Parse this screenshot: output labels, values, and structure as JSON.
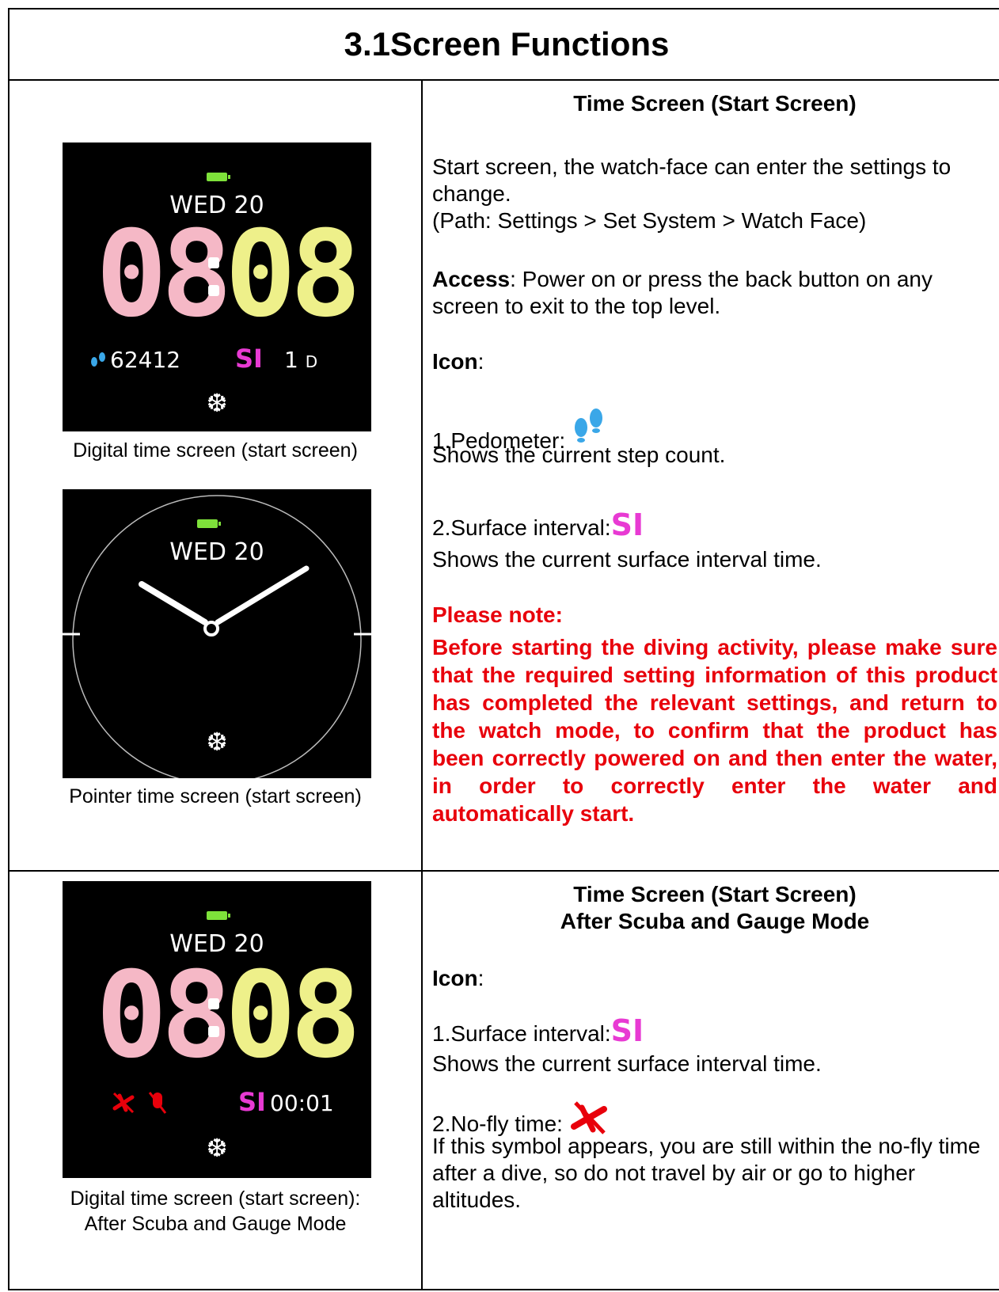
{
  "title": "3.1Screen Functions",
  "watch1": {
    "date": "WED 20",
    "hour": "08",
    "minute": "08",
    "steps": "62412",
    "si": "SI",
    "days": "1",
    "days_unit": "D"
  },
  "watch2": {
    "date": "WED 20"
  },
  "watch3": {
    "date": "WED 20",
    "hour": "08",
    "minute": "08",
    "si": "SI",
    "interval": "00:01"
  },
  "captions": {
    "c1": "Digital time screen (start screen)",
    "c2": "Pointer time screen (start screen)",
    "c3_line1": "Digital time screen (start screen):",
    "c3_line2": "After Scuba and Gauge Mode"
  },
  "section1": {
    "heading": "Time Screen (Start Screen)",
    "intro_line1": "Start screen, the watch-face can enter the settings to change.",
    "path": "(Path: Settings > Set System > Watch Face)",
    "access_label": "Access",
    "access_text": ": Power on or press the back button on any screen to exit to the top level.",
    "icon_label": "Icon",
    "icon_colon": ":",
    "item1_label": "1.Pedometer:",
    "item1_desc": "Shows the current step count.",
    "item2_label": "2.Surface interval:",
    "item2_icon": "SI",
    "item2_desc": "Shows the current surface interval time.",
    "note_title": "Please note:",
    "note_text": "Before starting the diving activity, please make sure that the required setting information of this product has completed the relevant settings, and return to the watch mode, to confirm that the product has been correctly powered on and then enter the water, in order to correctly enter the water and automatically start."
  },
  "section2": {
    "heading_line1": "Time Screen (Start Screen)",
    "heading_line2": "After Scuba and Gauge Mode",
    "icon_label": "Icon",
    "icon_colon": ":",
    "item1_label": "1.Surface interval:",
    "item1_icon": "SI",
    "item1_desc": "Shows the current surface interval time.",
    "item2_label": "2.No-fly time:",
    "item2_desc": "If this symbol appears, you are still within the no-fly time after a dive, so do not travel by air or go to higher altitudes."
  },
  "colors": {
    "pink": "#f5b8c6",
    "yellow": "#eef08a",
    "red": "#e8000b",
    "magenta": "#e83ad3",
    "blue": "#3aa7e8"
  }
}
